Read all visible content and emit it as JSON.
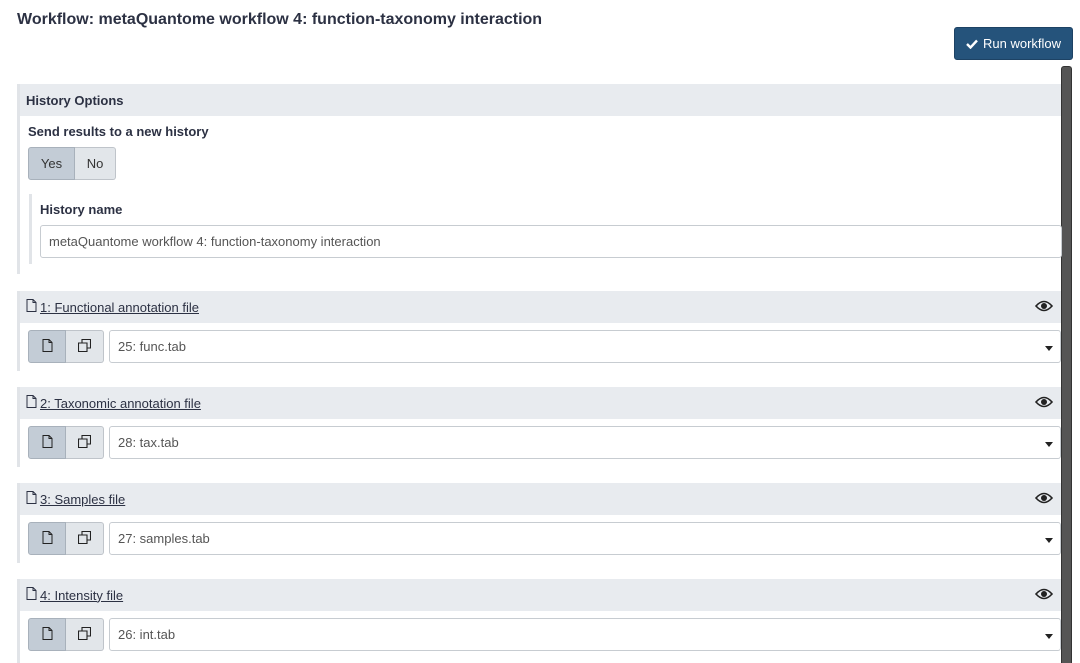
{
  "page": {
    "title": "Workflow: metaQuantome workflow 4: function-taxonomy interaction",
    "run_button": "Run workflow"
  },
  "history": {
    "header": "History Options",
    "send_label": "Send results to a new history",
    "toggle": {
      "yes": "Yes",
      "no": "No",
      "selected": "Yes"
    },
    "name_label": "History name",
    "name_value": "metaQuantome workflow 4: function-taxonomy interaction"
  },
  "steps": [
    {
      "label": "1: Functional annotation file",
      "value": "25: func.tab"
    },
    {
      "label": "2: Taxonomic annotation file",
      "value": "28: tax.tab"
    },
    {
      "label": "3: Samples file",
      "value": "27: samples.tab"
    },
    {
      "label": "4: Intensity file",
      "value": "26: int.tab"
    }
  ],
  "icons": {
    "run": "check-icon",
    "step": "file-icon",
    "visibility": "eye-icon",
    "single_dataset": "file-icon",
    "multiple_datasets": "copy-icon",
    "dropdown": "caret-down-icon"
  },
  "colors": {
    "primary": "#25537b",
    "panel_header": "#e8ebef",
    "active_toggle": "#c3ccd6",
    "text": "#2c3143"
  }
}
